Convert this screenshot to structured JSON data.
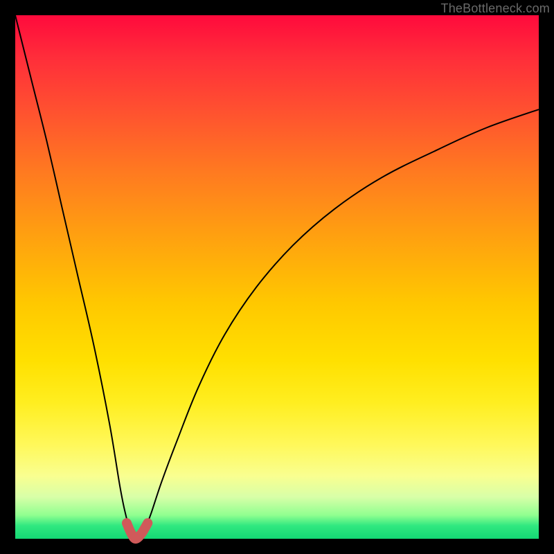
{
  "watermark": "TheBottleneck.com",
  "colors": {
    "frame_bg_top": "#ff0a3c",
    "frame_bg_bottom": "#14d874",
    "curve_main": "#000000",
    "curve_low_highlight": "#d05a5a",
    "page_bg": "#000000",
    "watermark": "#6a6a6a"
  },
  "chart_data": {
    "type": "line",
    "title": "",
    "xlabel": "",
    "ylabel": "",
    "x_range": [
      0,
      100
    ],
    "y_range": [
      0,
      100
    ],
    "grid": false,
    "legend": false,
    "notes": "V-shaped bottleneck curve. Minimum (~0%) near x≈23. Left branch rises steeply to ~100% at x=0; right branch rises with diminishing slope to ~82% at x=100. Low-bottleneck region (y≲3) highlighted in thick red around the trough.",
    "series": [
      {
        "name": "bottleneck",
        "x": [
          0,
          3,
          6,
          9,
          12,
          15,
          18,
          20,
          21,
          22,
          23,
          24,
          25,
          26,
          28,
          31,
          35,
          40,
          46,
          53,
          61,
          70,
          80,
          90,
          100
        ],
        "y": [
          100,
          88,
          76,
          63,
          50,
          37,
          22,
          10,
          5,
          1.5,
          0,
          1,
          2.5,
          5,
          11,
          19,
          29,
          39,
          48,
          56,
          63,
          69,
          74,
          78.5,
          82
        ]
      }
    ],
    "highlight_low_region": {
      "threshold_y": 3,
      "x_start": 21.3,
      "x_end": 25.3
    }
  }
}
